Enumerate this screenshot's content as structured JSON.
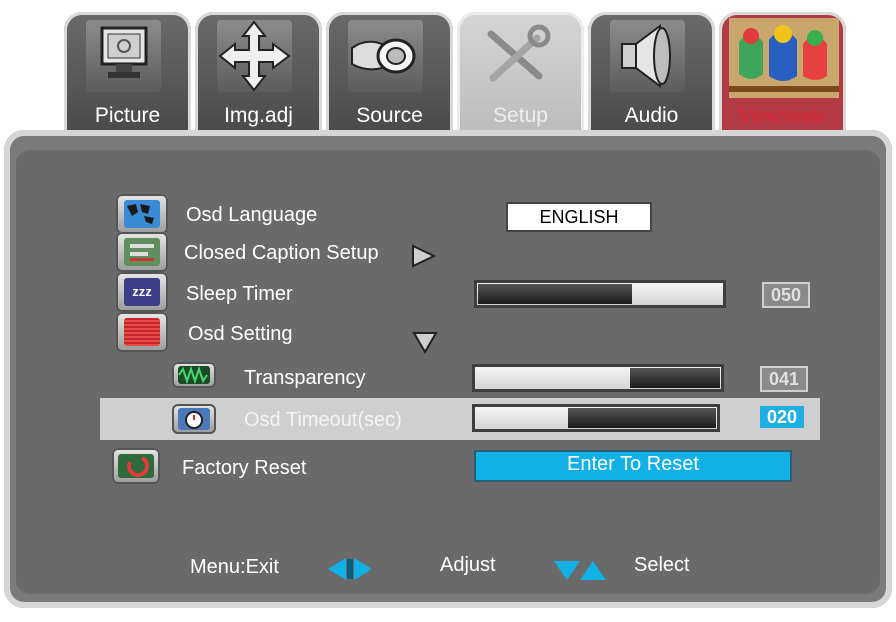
{
  "tabs": [
    {
      "label": "Picture",
      "icon": "monitor-icon"
    },
    {
      "label": "Img.adj",
      "icon": "move-arrows-icon"
    },
    {
      "label": "Source",
      "icon": "connector-icon"
    },
    {
      "label": "Setup",
      "icon": "tools-icon",
      "active": true
    },
    {
      "label": "Audio",
      "icon": "speaker-icon"
    },
    {
      "label": "ViewSonic",
      "icon": "birds-logo-icon"
    }
  ],
  "menu": {
    "osd_language": {
      "label": "Osd Language",
      "value": "ENGLISH",
      "icon": "world-map-icon"
    },
    "closed_caption": {
      "label": "Closed Caption Setup",
      "icon": "caption-icon"
    },
    "sleep_timer": {
      "label": "Sleep Timer",
      "value": "050",
      "level": 0.5,
      "icon": "zzz-icon"
    },
    "osd_setting": {
      "label": "Osd Setting",
      "icon": "osd-icon",
      "expanded": true
    },
    "transparency": {
      "label": "Transparency",
      "value": "041",
      "level": 0.41,
      "icon": "waveform-icon"
    },
    "osd_timeout": {
      "label": "Osd Timeout(sec)",
      "value": "020",
      "level": 0.2,
      "icon": "timer-icon",
      "selected": true
    },
    "factory_reset": {
      "label": "Factory Reset",
      "button": "Enter To Reset",
      "icon": "reset-icon"
    }
  },
  "footer": {
    "exit": "Menu:Exit",
    "adjust": "Adjust",
    "select": "Select"
  },
  "colors": {
    "accent": "#11b1e8",
    "panel": "#6a6a6a",
    "brand": "#d8293a"
  }
}
